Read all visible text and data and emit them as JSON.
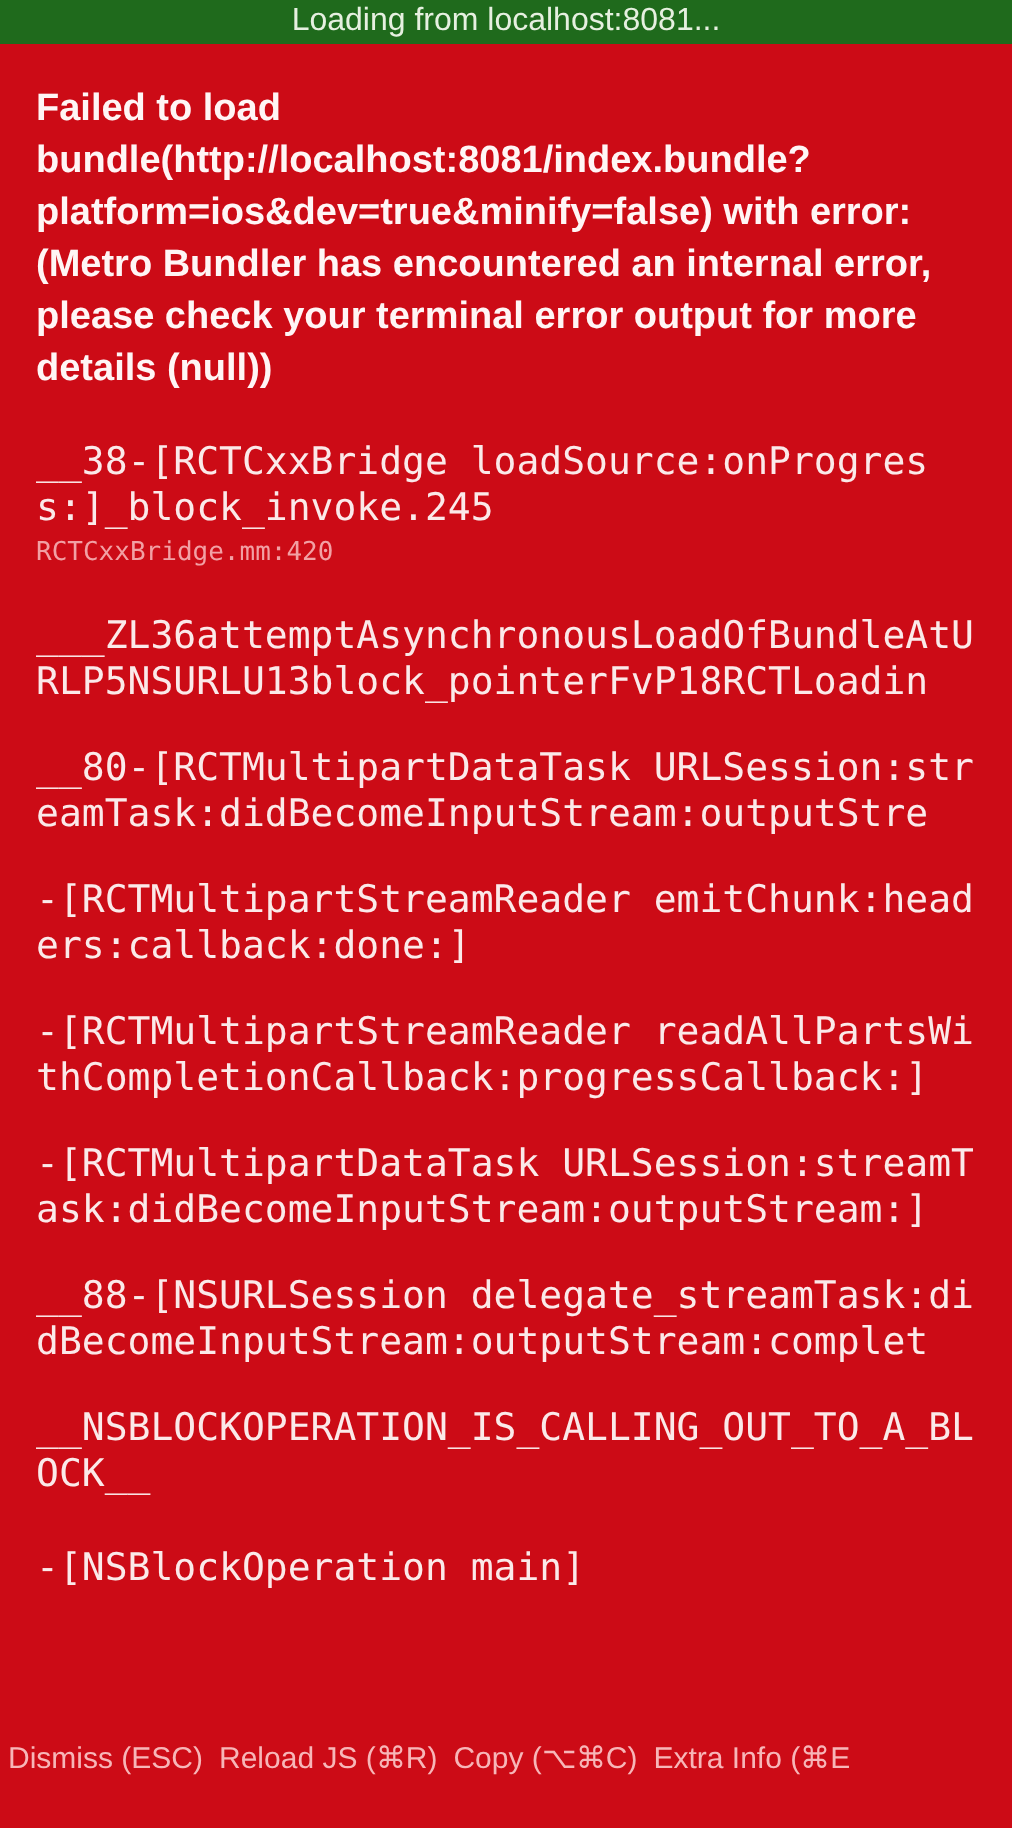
{
  "loading_banner": {
    "text": "Loading from localhost:8081..."
  },
  "error_message": "Failed to load bundle(http://localhost:8081/index.bundle?platform=ios&dev=true&minify=false) with error:(Metro Bundler has encountered an internal error, please check your terminal error output for more details (null))",
  "stack_frames": [
    {
      "method": "__38-[RCTCxxBridge loadSource:onProgress:]_block_invoke.245",
      "file": "RCTCxxBridge.mm:420"
    },
    {
      "method": "___ZL36attemptAsynchronousLoadOfBundleAtURLP5NSURLU13block_pointerFvP18RCTLoadin"
    },
    {
      "method": "__80-[RCTMultipartDataTask URLSession:streamTask:didBecomeInputStream:outputStre"
    },
    {
      "method": "-[RCTMultipartStreamReader emitChunk:headers:callback:done:]"
    },
    {
      "method": "-[RCTMultipartStreamReader readAllPartsWithCompletionCallback:progressCallback:]"
    },
    {
      "method": "-[RCTMultipartDataTask URLSession:streamTask:didBecomeInputStream:outputStream:]"
    },
    {
      "method": "__88-[NSURLSession delegate_streamTask:didBecomeInputStream:outputStream:complet"
    },
    {
      "method": "__NSBLOCKOPERATION_IS_CALLING_OUT_TO_A_BLOCK__"
    },
    {
      "method": "-[NSBlockOperation main]"
    }
  ],
  "buttons": [
    "Dismiss (ESC)",
    "Reload JS (⌘R)",
    "Copy (⌥⌘C)",
    "Extra Info (⌘E"
  ]
}
